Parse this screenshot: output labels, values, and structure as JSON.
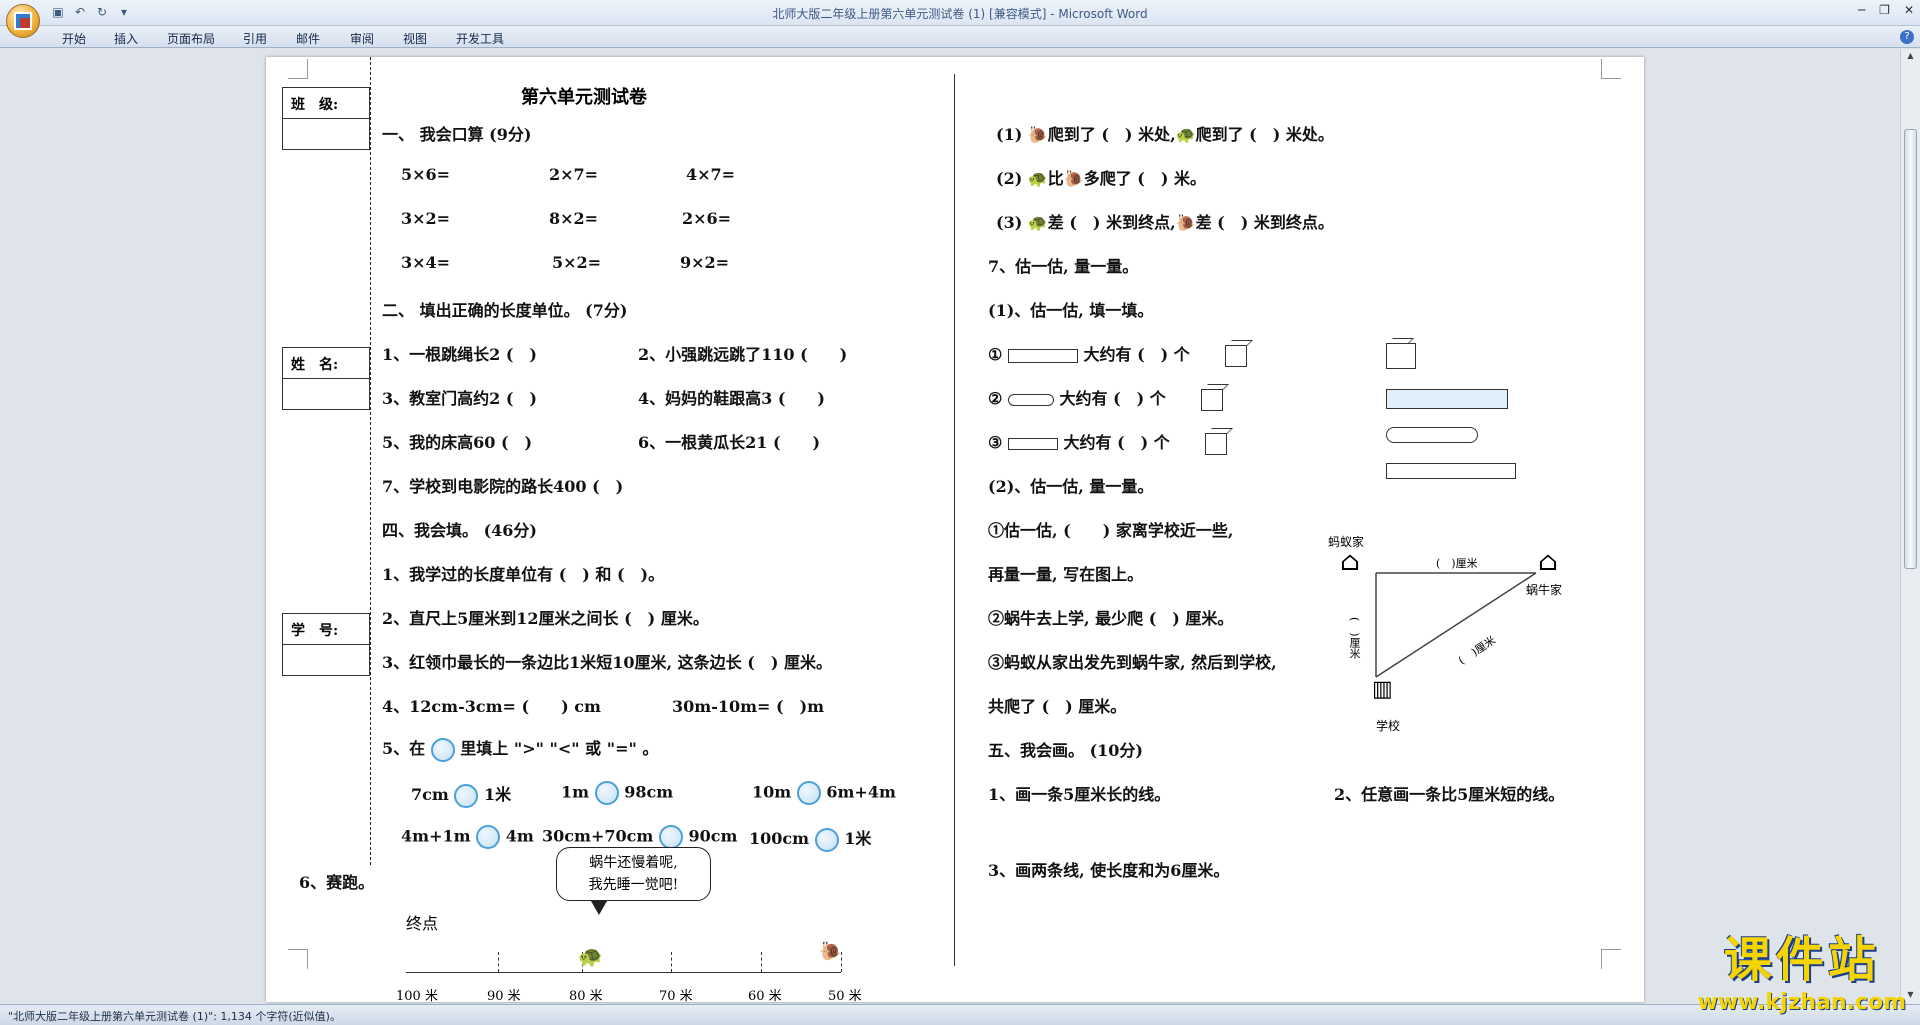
{
  "app": {
    "window_title": "北师大版二年级上册第六单元测试卷 (1) [兼容模式] - Microsoft Word",
    "tabs": [
      "开始",
      "插入",
      "页面布局",
      "引用",
      "邮件",
      "审阅",
      "视图",
      "开发工具"
    ],
    "status_text": "\"北师大版二年级上册第六单元测试卷 (1)\": 1,134 个字符(近似值)。"
  },
  "sidebar": {
    "class_label": "班　级:",
    "name_label": "姓　名:",
    "id_label": "学　号:"
  },
  "doc": {
    "title": "第六单元测试卷",
    "s1": "一、 我会口算 (9分)",
    "calc": [
      [
        "5×6=",
        "2×7=",
        "4×7="
      ],
      [
        "3×2=",
        "8×2=",
        "2×6="
      ],
      [
        "3×4=",
        "5×2=",
        "9×2="
      ]
    ],
    "s2": "二、 填出正确的长度单位。 (7分)",
    "units": [
      [
        "1、一根跳绳长2 (　)",
        "2、小强跳远跳了110 (　　)"
      ],
      [
        "3、教室门高约2 (　)",
        "4、妈妈的鞋跟高3 (　　)"
      ],
      [
        "5、我的床高60 (　)",
        "6、一根黄瓜长21 (　　)"
      ]
    ],
    "unit7": "7、学校到电影院的路长400 (　)",
    "s4": "四、我会填。 (46分)",
    "fill1": "1、我学过的长度单位有 (　) 和 (　)。",
    "fill2": "2、直尺上5厘米到12厘米之间长 (　) 厘米。",
    "fill3": "3、红领巾最长的一条边比1米短10厘米, 这条边长 (　) 厘米。",
    "fill4a": "4、12cm-3cm= (　　) cm",
    "fill4b": "30m-10m= (　)m",
    "fill5": [
      "5、在",
      "里填上 \">\" \"<\" 或 \"=\" 。"
    ],
    "cmp_row1": [
      [
        "7cm",
        "1米"
      ],
      [
        "1m",
        "98cm"
      ],
      [
        "10m",
        "6m+4m"
      ]
    ],
    "cmp_row2": [
      [
        "4m+1m",
        "4m"
      ],
      [
        "30cm+70cm",
        "90cm"
      ],
      [
        "100cm",
        "1米"
      ]
    ],
    "s6": "6、赛跑。",
    "bubble": [
      "蜗牛还慢着呢,",
      "我先睡一觉吧!"
    ],
    "finish": "终点",
    "track_labels": [
      "100 米",
      "90 米",
      "80 米",
      "70 米",
      "60 米",
      "50 米"
    ]
  },
  "right": {
    "q1": [
      "(1)",
      "爬到了 (　) 米处,",
      "爬到了 (　) 米处。"
    ],
    "q2": [
      "(2)",
      "比",
      "多爬了 (　) 米。"
    ],
    "q3": [
      "(3)",
      "差 (　) 米到终点,",
      "差 (　) 米到终点。"
    ],
    "s7": "7、估一估, 量一量。",
    "e1": "(1)、估一估, 填一填。",
    "e1_rows": [
      "①",
      "大约有 (　) 个",
      "②",
      "大约有 (　) 个",
      "③",
      "大约有 (　) 个"
    ],
    "e2": "(2)、估一估, 量一量。",
    "e2a": "①估一估, (　　) 家离学校近一些,",
    "e2b": "再量一量, 写在图上。",
    "e2c": "②蜗牛去上学, 最少爬 (　) 厘米。",
    "e2d": "③蚂蚁从家出发先到蜗牛家, 然后到学校,",
    "e2e": "共爬了 (　) 厘米。",
    "map_labels": [
      "蚂蚁家",
      "蜗牛家",
      "学校",
      "(　)厘米",
      "(　)厘米",
      "(　)厘米"
    ],
    "s5": "五、我会画。 (10分)",
    "d1": "1、画一条5厘米长的线。",
    "d2": "2、任意画一条比5厘米短的线。",
    "d3": "3、画两条线, 使长度和为6厘米。"
  },
  "watermark": {
    "brand": "课件站",
    "url": "www.kjzhan.com"
  }
}
